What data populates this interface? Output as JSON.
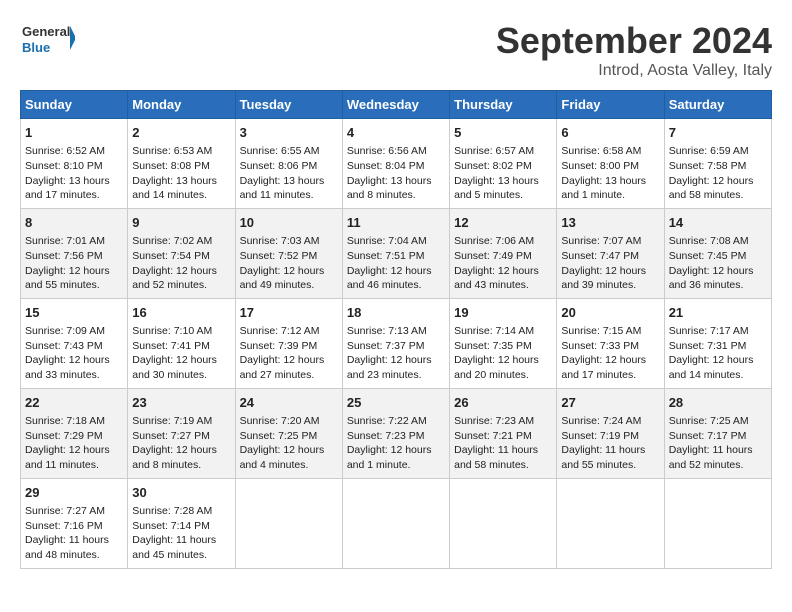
{
  "header": {
    "logo_general": "General",
    "logo_blue": "Blue",
    "month_title": "September 2024",
    "location": "Introd, Aosta Valley, Italy"
  },
  "columns": [
    "Sunday",
    "Monday",
    "Tuesday",
    "Wednesday",
    "Thursday",
    "Friday",
    "Saturday"
  ],
  "weeks": [
    [
      {
        "day": "1",
        "info": "Sunrise: 6:52 AM\nSunset: 8:10 PM\nDaylight: 13 hours and 17 minutes."
      },
      {
        "day": "2",
        "info": "Sunrise: 6:53 AM\nSunset: 8:08 PM\nDaylight: 13 hours and 14 minutes."
      },
      {
        "day": "3",
        "info": "Sunrise: 6:55 AM\nSunset: 8:06 PM\nDaylight: 13 hours and 11 minutes."
      },
      {
        "day": "4",
        "info": "Sunrise: 6:56 AM\nSunset: 8:04 PM\nDaylight: 13 hours and 8 minutes."
      },
      {
        "day": "5",
        "info": "Sunrise: 6:57 AM\nSunset: 8:02 PM\nDaylight: 13 hours and 5 minutes."
      },
      {
        "day": "6",
        "info": "Sunrise: 6:58 AM\nSunset: 8:00 PM\nDaylight: 13 hours and 1 minute."
      },
      {
        "day": "7",
        "info": "Sunrise: 6:59 AM\nSunset: 7:58 PM\nDaylight: 12 hours and 58 minutes."
      }
    ],
    [
      {
        "day": "8",
        "info": "Sunrise: 7:01 AM\nSunset: 7:56 PM\nDaylight: 12 hours and 55 minutes."
      },
      {
        "day": "9",
        "info": "Sunrise: 7:02 AM\nSunset: 7:54 PM\nDaylight: 12 hours and 52 minutes."
      },
      {
        "day": "10",
        "info": "Sunrise: 7:03 AM\nSunset: 7:52 PM\nDaylight: 12 hours and 49 minutes."
      },
      {
        "day": "11",
        "info": "Sunrise: 7:04 AM\nSunset: 7:51 PM\nDaylight: 12 hours and 46 minutes."
      },
      {
        "day": "12",
        "info": "Sunrise: 7:06 AM\nSunset: 7:49 PM\nDaylight: 12 hours and 43 minutes."
      },
      {
        "day": "13",
        "info": "Sunrise: 7:07 AM\nSunset: 7:47 PM\nDaylight: 12 hours and 39 minutes."
      },
      {
        "day": "14",
        "info": "Sunrise: 7:08 AM\nSunset: 7:45 PM\nDaylight: 12 hours and 36 minutes."
      }
    ],
    [
      {
        "day": "15",
        "info": "Sunrise: 7:09 AM\nSunset: 7:43 PM\nDaylight: 12 hours and 33 minutes."
      },
      {
        "day": "16",
        "info": "Sunrise: 7:10 AM\nSunset: 7:41 PM\nDaylight: 12 hours and 30 minutes."
      },
      {
        "day": "17",
        "info": "Sunrise: 7:12 AM\nSunset: 7:39 PM\nDaylight: 12 hours and 27 minutes."
      },
      {
        "day": "18",
        "info": "Sunrise: 7:13 AM\nSunset: 7:37 PM\nDaylight: 12 hours and 23 minutes."
      },
      {
        "day": "19",
        "info": "Sunrise: 7:14 AM\nSunset: 7:35 PM\nDaylight: 12 hours and 20 minutes."
      },
      {
        "day": "20",
        "info": "Sunrise: 7:15 AM\nSunset: 7:33 PM\nDaylight: 12 hours and 17 minutes."
      },
      {
        "day": "21",
        "info": "Sunrise: 7:17 AM\nSunset: 7:31 PM\nDaylight: 12 hours and 14 minutes."
      }
    ],
    [
      {
        "day": "22",
        "info": "Sunrise: 7:18 AM\nSunset: 7:29 PM\nDaylight: 12 hours and 11 minutes."
      },
      {
        "day": "23",
        "info": "Sunrise: 7:19 AM\nSunset: 7:27 PM\nDaylight: 12 hours and 8 minutes."
      },
      {
        "day": "24",
        "info": "Sunrise: 7:20 AM\nSunset: 7:25 PM\nDaylight: 12 hours and 4 minutes."
      },
      {
        "day": "25",
        "info": "Sunrise: 7:22 AM\nSunset: 7:23 PM\nDaylight: 12 hours and 1 minute."
      },
      {
        "day": "26",
        "info": "Sunrise: 7:23 AM\nSunset: 7:21 PM\nDaylight: 11 hours and 58 minutes."
      },
      {
        "day": "27",
        "info": "Sunrise: 7:24 AM\nSunset: 7:19 PM\nDaylight: 11 hours and 55 minutes."
      },
      {
        "day": "28",
        "info": "Sunrise: 7:25 AM\nSunset: 7:17 PM\nDaylight: 11 hours and 52 minutes."
      }
    ],
    [
      {
        "day": "29",
        "info": "Sunrise: 7:27 AM\nSunset: 7:16 PM\nDaylight: 11 hours and 48 minutes."
      },
      {
        "day": "30",
        "info": "Sunrise: 7:28 AM\nSunset: 7:14 PM\nDaylight: 11 hours and 45 minutes."
      },
      null,
      null,
      null,
      null,
      null
    ]
  ]
}
